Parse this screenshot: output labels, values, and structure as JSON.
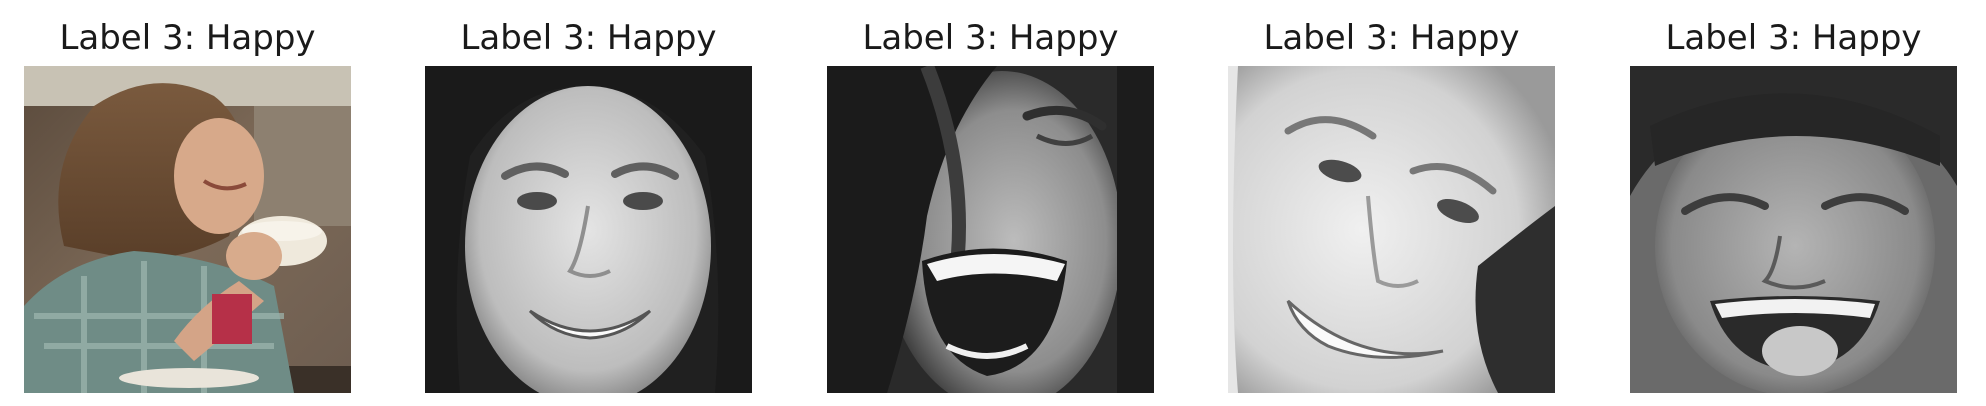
{
  "panels": [
    {
      "title": "Label 3: Happy",
      "image": "color photo of a smiling woman with wavy brown hair holding a white cup, plaid shirt, cafe background"
    },
    {
      "title": "Label 3: Happy",
      "image": "grayscale close-up of a smiling woman's face with dark hair"
    },
    {
      "title": "Label 3: Happy",
      "image": "grayscale close-up of a laughing woman with open mouth and hair across face"
    },
    {
      "title": "Label 3: Happy",
      "image": "grayscale close-up of a smiling woman's face, tilted"
    },
    {
      "title": "Label 3: Happy",
      "image": "grayscale close-up of a laughing child with tongue out"
    }
  ]
}
